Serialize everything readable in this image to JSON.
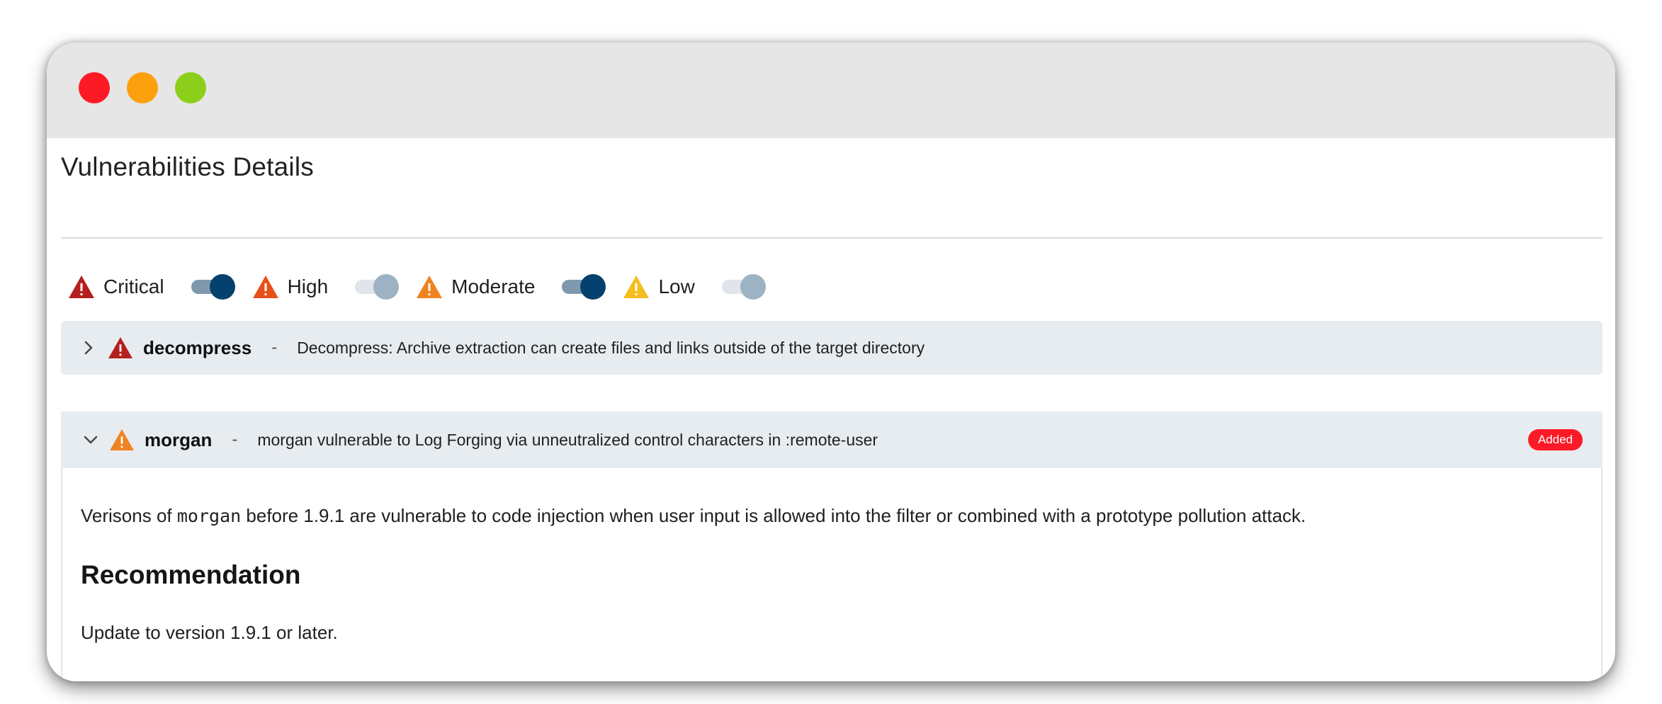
{
  "window": {
    "controls": [
      "close",
      "minimize",
      "maximize"
    ]
  },
  "page": {
    "title": "Vulnerabilities Details"
  },
  "filters": [
    {
      "label": "Critical",
      "icon": "warning-triangle-icon",
      "color": "#b3201e",
      "enabled": true
    },
    {
      "label": "High",
      "icon": "warning-triangle-icon",
      "color": "#e8501b",
      "enabled": false
    },
    {
      "label": "Moderate",
      "icon": "warning-triangle-icon",
      "color": "#f08320",
      "enabled": true
    },
    {
      "label": "Low",
      "icon": "warning-triangle-icon",
      "color": "#f6bd1f",
      "enabled": false
    }
  ],
  "vulnerabilities": [
    {
      "package": "decompress",
      "separator": "-",
      "summary": "Decompress: Archive extraction can create files and links outside of the target directory",
      "severity_color": "#b3201e",
      "expanded": false
    },
    {
      "package": "morgan",
      "separator": "-",
      "summary": "morgan vulnerable to Log Forging via unneutralized control characters in :remote-user",
      "severity_color": "#f08320",
      "expanded": true,
      "badge": "Added",
      "details": {
        "text_before": "Verisons of ",
        "code": "morgan",
        "text_after": " before 1.9.1 are vulnerable to code injection when user input is allowed into the filter or combined with a prototype pollution attack.",
        "recommendation_heading": "Recommendation",
        "recommendation_text": "Update to version 1.9.1 or later."
      }
    }
  ],
  "colors": {
    "toggle_on_knob": "#04416e",
    "toggle_off_knob": "#9db3c4",
    "badge": "#fb1a27",
    "row_bg": "#e7ecf0"
  }
}
